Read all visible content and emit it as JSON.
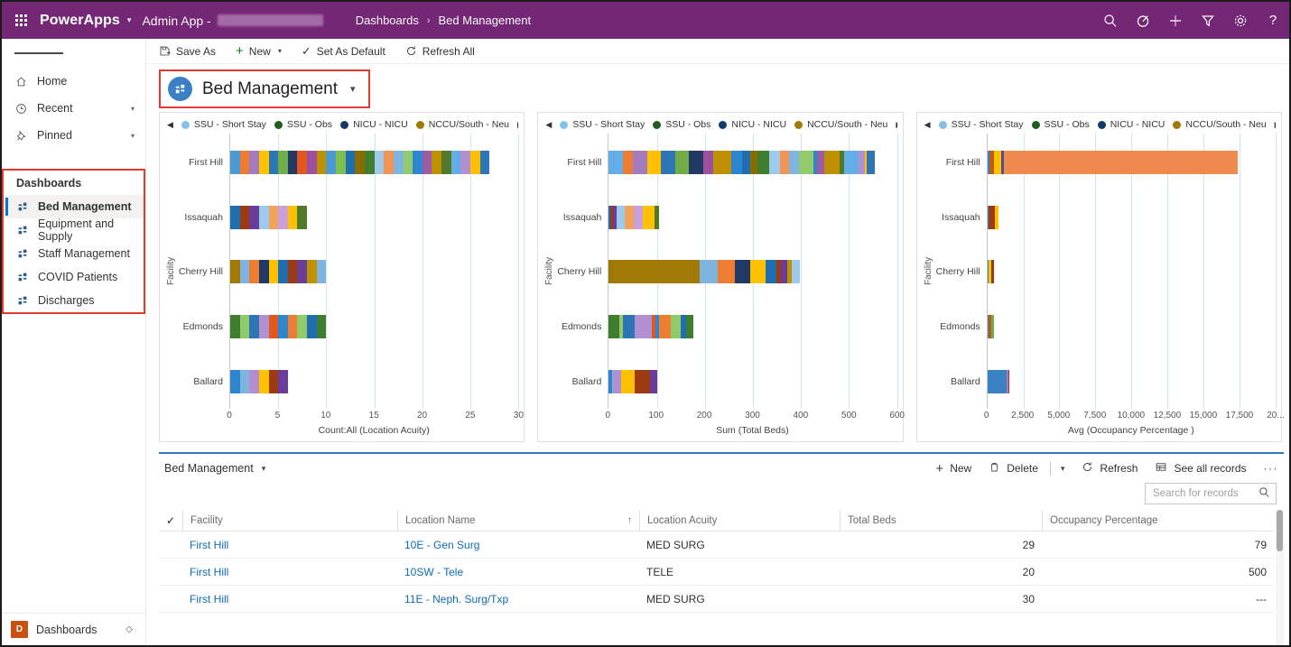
{
  "topbar": {
    "waffle_name": "app-launcher",
    "brand": "PowerApps",
    "app_name": "Admin App -",
    "breadcrumb": [
      "Dashboards",
      "Bed Management"
    ],
    "breadcrumb_sep": "›",
    "icons": [
      "search-icon",
      "filter-advanced-icon",
      "add-icon",
      "funnel-icon",
      "settings-icon",
      "help-icon"
    ],
    "bg": "#742774"
  },
  "sidebar": {
    "nav": [
      {
        "label": "Home",
        "icon": "home-icon",
        "expandable": false
      },
      {
        "label": "Recent",
        "icon": "clock-icon",
        "expandable": true
      },
      {
        "label": "Pinned",
        "icon": "pin-icon",
        "expandable": true
      }
    ],
    "section_title": "Dashboards",
    "dashboards": [
      {
        "label": "Bed Management",
        "selected": true
      },
      {
        "label": "Equipment and Supply",
        "selected": false
      },
      {
        "label": "Staff Management",
        "selected": false
      },
      {
        "label": "COVID Patients",
        "selected": false
      },
      {
        "label": "Discharges",
        "selected": false
      }
    ],
    "footer": {
      "badge": "D",
      "label": "Dashboards",
      "switch_icon": "chevron-updown-icon"
    },
    "highlight_color": "#e03a32"
  },
  "commandbar": {
    "save_as": "Save As",
    "new": "New",
    "set_as_default": "Set As Default",
    "refresh_all": "Refresh All"
  },
  "dashboard_header": {
    "title": "Bed Management",
    "icon": "dashboard-icon",
    "chevron": "chevron-down-icon",
    "circle_color": "#3b7fc4",
    "highlight_color": "#e03a32"
  },
  "legend": {
    "prev": "◀",
    "next": "▶",
    "items": [
      {
        "label": "SSU - Short Stay",
        "color": "#86c0e8"
      },
      {
        "label": "SSU - Obs",
        "color": "#1e5c23"
      },
      {
        "label": "NICU - NICU",
        "color": "#123a66"
      },
      {
        "label": "NCCU/South - Neu",
        "color": "#a07a05"
      }
    ]
  },
  "chart_data": [
    {
      "type": "bar",
      "orientation": "horizontal",
      "stacked": true,
      "title": "",
      "xlabel": "Count:All (Location Acuity)",
      "ylabel": "Facility",
      "categories": [
        "First Hill",
        "Issaquah",
        "Cherry Hill",
        "Edmonds",
        "Ballard"
      ],
      "values": [
        27,
        8,
        10,
        10,
        6
      ],
      "xlim": [
        0,
        30
      ],
      "xticks": [
        0,
        5,
        10,
        15,
        20,
        25,
        30
      ],
      "grid": true,
      "legend_position": "top",
      "stacks": {
        "First Hill": [
          {
            "v": 1,
            "c": "#4a9ad4"
          },
          {
            "v": 1,
            "c": "#ed7d31"
          },
          {
            "v": 1,
            "c": "#a57bbf"
          },
          {
            "v": 1,
            "c": "#ffc000"
          },
          {
            "v": 1,
            "c": "#2e75b6"
          },
          {
            "v": 1,
            "c": "#70ad47"
          },
          {
            "v": 1,
            "c": "#1f3864"
          },
          {
            "v": 1,
            "c": "#e2571e"
          },
          {
            "v": 1,
            "c": "#9e4f9e"
          },
          {
            "v": 1,
            "c": "#bf9000"
          },
          {
            "v": 1,
            "c": "#4a9ad4"
          },
          {
            "v": 1,
            "c": "#7fbf4d"
          },
          {
            "v": 1,
            "c": "#1f6fb0"
          },
          {
            "v": 1,
            "c": "#8a6d00"
          },
          {
            "v": 1,
            "c": "#3f7d2f"
          },
          {
            "v": 1,
            "c": "#9dc9ea"
          },
          {
            "v": 1,
            "c": "#f09553"
          },
          {
            "v": 1,
            "c": "#7fb4e0"
          },
          {
            "v": 1,
            "c": "#8fcb6b"
          },
          {
            "v": 1,
            "c": "#2e86d0"
          },
          {
            "v": 1,
            "c": "#9b5ba5"
          },
          {
            "v": 1,
            "c": "#bf9000"
          },
          {
            "v": 1,
            "c": "#4f7a2a"
          },
          {
            "v": 1,
            "c": "#63aee6"
          },
          {
            "v": 1,
            "c": "#b18fd0"
          },
          {
            "v": 1,
            "c": "#ffc000"
          },
          {
            "v": 1,
            "c": "#2e75b6"
          }
        ],
        "Issaquah": [
          {
            "v": 1,
            "c": "#1f6fb0"
          },
          {
            "v": 1,
            "c": "#9c3a12"
          },
          {
            "v": 1,
            "c": "#6a3d9a"
          },
          {
            "v": 1,
            "c": "#9dc9ea"
          },
          {
            "v": 1,
            "c": "#f2a25c"
          },
          {
            "v": 1,
            "c": "#c9a0dc"
          },
          {
            "v": 1,
            "c": "#ffc000"
          },
          {
            "v": 1,
            "c": "#4f7a2a"
          }
        ],
        "Cherry Hill": [
          {
            "v": 1,
            "c": "#a07a05"
          },
          {
            "v": 1,
            "c": "#7fb4e0"
          },
          {
            "v": 1,
            "c": "#ed7d31"
          },
          {
            "v": 1,
            "c": "#1f3864"
          },
          {
            "v": 1,
            "c": "#ffc000"
          },
          {
            "v": 1,
            "c": "#1f6fb0"
          },
          {
            "v": 1,
            "c": "#9c3a12"
          },
          {
            "v": 1,
            "c": "#6a3d9a"
          },
          {
            "v": 1,
            "c": "#bf9000"
          },
          {
            "v": 1,
            "c": "#7fb4e0"
          }
        ],
        "Edmonds": [
          {
            "v": 1,
            "c": "#3f7d2f"
          },
          {
            "v": 1,
            "c": "#8fcb6b"
          },
          {
            "v": 1,
            "c": "#2e75b6"
          },
          {
            "v": 1,
            "c": "#b18fd0"
          },
          {
            "v": 1,
            "c": "#e2571e"
          },
          {
            "v": 1,
            "c": "#2e86d0"
          },
          {
            "v": 1,
            "c": "#ed7d31"
          },
          {
            "v": 1,
            "c": "#8fcb6b"
          },
          {
            "v": 1,
            "c": "#1f6fb0"
          },
          {
            "v": 1,
            "c": "#3f7d2f"
          }
        ],
        "Ballard": [
          {
            "v": 1,
            "c": "#2e86d0"
          },
          {
            "v": 1,
            "c": "#7fb4e0"
          },
          {
            "v": 1,
            "c": "#b18fd0"
          },
          {
            "v": 1,
            "c": "#ffc000"
          },
          {
            "v": 1,
            "c": "#9c3a12"
          },
          {
            "v": 1,
            "c": "#6a3d9a"
          }
        ]
      }
    },
    {
      "type": "bar",
      "orientation": "horizontal",
      "stacked": true,
      "title": "",
      "xlabel": "Sum (Total Beds)",
      "ylabel": "Facility",
      "categories": [
        "First Hill",
        "Issaquah",
        "Cherry Hill",
        "Edmonds",
        "Ballard"
      ],
      "values": [
        565,
        105,
        397,
        176,
        100
      ],
      "xlim": [
        0,
        600
      ],
      "xticks": [
        0,
        100,
        200,
        300,
        400,
        500,
        600
      ],
      "grid": true,
      "legend_position": "top",
      "stacks": {
        "First Hill": [
          {
            "v": 30,
            "c": "#63aee6"
          },
          {
            "v": 20,
            "c": "#ed7d31"
          },
          {
            "v": 30,
            "c": "#a57bbf"
          },
          {
            "v": 28,
            "c": "#ffc000"
          },
          {
            "v": 30,
            "c": "#2e75b6"
          },
          {
            "v": 28,
            "c": "#70ad47"
          },
          {
            "v": 30,
            "c": "#1f3864"
          },
          {
            "v": 22,
            "c": "#9e4f9e"
          },
          {
            "v": 38,
            "c": "#bf9000"
          },
          {
            "v": 22,
            "c": "#2e86d0"
          },
          {
            "v": 16,
            "c": "#1f6fb0"
          },
          {
            "v": 16,
            "c": "#8a6d00"
          },
          {
            "v": 24,
            "c": "#3f7d2f"
          },
          {
            "v": 22,
            "c": "#9dc9ea"
          },
          {
            "v": 20,
            "c": "#f09553"
          },
          {
            "v": 20,
            "c": "#7fb4e0"
          },
          {
            "v": 30,
            "c": "#8fcb6b"
          },
          {
            "v": 8,
            "c": "#2e86d0"
          },
          {
            "v": 14,
            "c": "#9b5ba5"
          },
          {
            "v": 32,
            "c": "#bf9000"
          },
          {
            "v": 10,
            "c": "#4f7a2a"
          },
          {
            "v": 30,
            "c": "#63aee6"
          },
          {
            "v": 14,
            "c": "#b18fd0"
          },
          {
            "v": 4,
            "c": "#ffc000"
          },
          {
            "v": 17,
            "c": "#2e75b6"
          }
        ],
        "Issaquah": [
          {
            "v": 4,
            "c": "#1f6fb0"
          },
          {
            "v": 4,
            "c": "#9c3a12"
          },
          {
            "v": 8,
            "c": "#6a3d9a"
          },
          {
            "v": 18,
            "c": "#9dc9ea"
          },
          {
            "v": 18,
            "c": "#f2a25c"
          },
          {
            "v": 18,
            "c": "#c9a0dc"
          },
          {
            "v": 25,
            "c": "#ffc000"
          },
          {
            "v": 10,
            "c": "#4f7a2a"
          }
        ],
        "Cherry Hill": [
          {
            "v": 189,
            "c": "#a07a05"
          },
          {
            "v": 37,
            "c": "#7fb4e0"
          },
          {
            "v": 36,
            "c": "#ed7d31"
          },
          {
            "v": 33,
            "c": "#1f3864"
          },
          {
            "v": 32,
            "c": "#ffc000"
          },
          {
            "v": 22,
            "c": "#1f6fb0"
          },
          {
            "v": 10,
            "c": "#9c3a12"
          },
          {
            "v": 12,
            "c": "#6a3d9a"
          },
          {
            "v": 10,
            "c": "#bf9000"
          },
          {
            "v": 16,
            "c": "#9dc9ea"
          }
        ],
        "Edmonds": [
          {
            "v": 22,
            "c": "#3f7d2f"
          },
          {
            "v": 8,
            "c": "#8fcb6b"
          },
          {
            "v": 24,
            "c": "#2e75b6"
          },
          {
            "v": 36,
            "c": "#b18fd0"
          },
          {
            "v": 8,
            "c": "#e2571e"
          },
          {
            "v": 6,
            "c": "#2e86d0"
          },
          {
            "v": 26,
            "c": "#ed7d31"
          },
          {
            "v": 20,
            "c": "#8fcb6b"
          },
          {
            "v": 12,
            "c": "#1f6fb0"
          },
          {
            "v": 14,
            "c": "#3f7d2f"
          }
        ],
        "Ballard": [
          {
            "v": 6,
            "c": "#2e86d0"
          },
          {
            "v": 3,
            "c": "#7fb4e0"
          },
          {
            "v": 17,
            "c": "#b18fd0"
          },
          {
            "v": 28,
            "c": "#ffc000"
          },
          {
            "v": 32,
            "c": "#9c3a12"
          },
          {
            "v": 14,
            "c": "#6a3d9a"
          }
        ]
      }
    },
    {
      "type": "bar",
      "orientation": "horizontal",
      "stacked": true,
      "title": "",
      "xlabel": "Avg (Occupancy Percentage )",
      "ylabel": "Facility",
      "categories": [
        "First Hill",
        "Issaquah",
        "Cherry Hill",
        "Edmonds",
        "Ballard"
      ],
      "values": [
        17400,
        800,
        450,
        460,
        1550
      ],
      "xlim": [
        0,
        20000
      ],
      "xticks": [
        "0",
        "2,500",
        "5,000",
        "7,500",
        "10,000",
        "12,500",
        "15,000",
        "17,500",
        "20..."
      ],
      "grid": true,
      "legend_position": "top",
      "stacks": {
        "First Hill": [
          {
            "v": 120,
            "c": "#2e86d0"
          },
          {
            "v": 330,
            "c": "#c05a10"
          },
          {
            "v": 520,
            "c": "#ffc000"
          },
          {
            "v": 90,
            "c": "#6a3d9a"
          },
          {
            "v": 120,
            "c": "#1f6fb0"
          },
          {
            "v": 16220,
            "c": "#ef8a4e"
          }
        ],
        "Issaquah": [
          {
            "v": 60,
            "c": "#2e86d0"
          },
          {
            "v": 440,
            "c": "#9c3a12"
          },
          {
            "v": 300,
            "c": "#ffc000"
          }
        ],
        "Cherry Hill": [
          {
            "v": 60,
            "c": "#2e86d0"
          },
          {
            "v": 230,
            "c": "#ffc000"
          },
          {
            "v": 160,
            "c": "#9c3a12"
          }
        ],
        "Edmonds": [
          {
            "v": 60,
            "c": "#2e86d0"
          },
          {
            "v": 200,
            "c": "#c05a10"
          },
          {
            "v": 200,
            "c": "#70ad47"
          }
        ],
        "Ballard": [
          {
            "v": 1340,
            "c": "#3b82c4"
          },
          {
            "v": 110,
            "c": "#a57bbf"
          },
          {
            "v": 100,
            "c": "#9c3a12"
          }
        ]
      }
    }
  ],
  "subgrid": {
    "title": "Bed Management",
    "actions": [
      {
        "label": "New",
        "icon": "add-icon"
      },
      {
        "label": "Delete",
        "icon": "trash-icon"
      },
      {
        "label": "Refresh",
        "icon": "refresh-icon"
      },
      {
        "label": "See all records",
        "icon": "grid-icon"
      }
    ],
    "overflow": "···",
    "search_placeholder": "Search for records",
    "search_value": "",
    "columns": [
      {
        "label": "Facility",
        "sorted": false,
        "align": "left"
      },
      {
        "label": "Location Name",
        "sorted": true,
        "sort_dir": "↑",
        "align": "left"
      },
      {
        "label": "Location Acuity",
        "sorted": false,
        "align": "left"
      },
      {
        "label": "Total Beds",
        "sorted": false,
        "align": "right"
      },
      {
        "label": "Occupancy Percentage",
        "sorted": false,
        "align": "right"
      }
    ],
    "rows": [
      {
        "facility": "First Hill",
        "location_name": "10E - Gen Surg",
        "location_acuity": "MED SURG",
        "total_beds": "29",
        "occupancy": "79"
      },
      {
        "facility": "First Hill",
        "location_name": "10SW - Tele",
        "location_acuity": "TELE",
        "total_beds": "20",
        "occupancy": "500"
      },
      {
        "facility": "First Hill",
        "location_name": "11E - Neph. Surg/Txp",
        "location_acuity": "MED SURG",
        "total_beds": "30",
        "occupancy": "---"
      }
    ]
  }
}
